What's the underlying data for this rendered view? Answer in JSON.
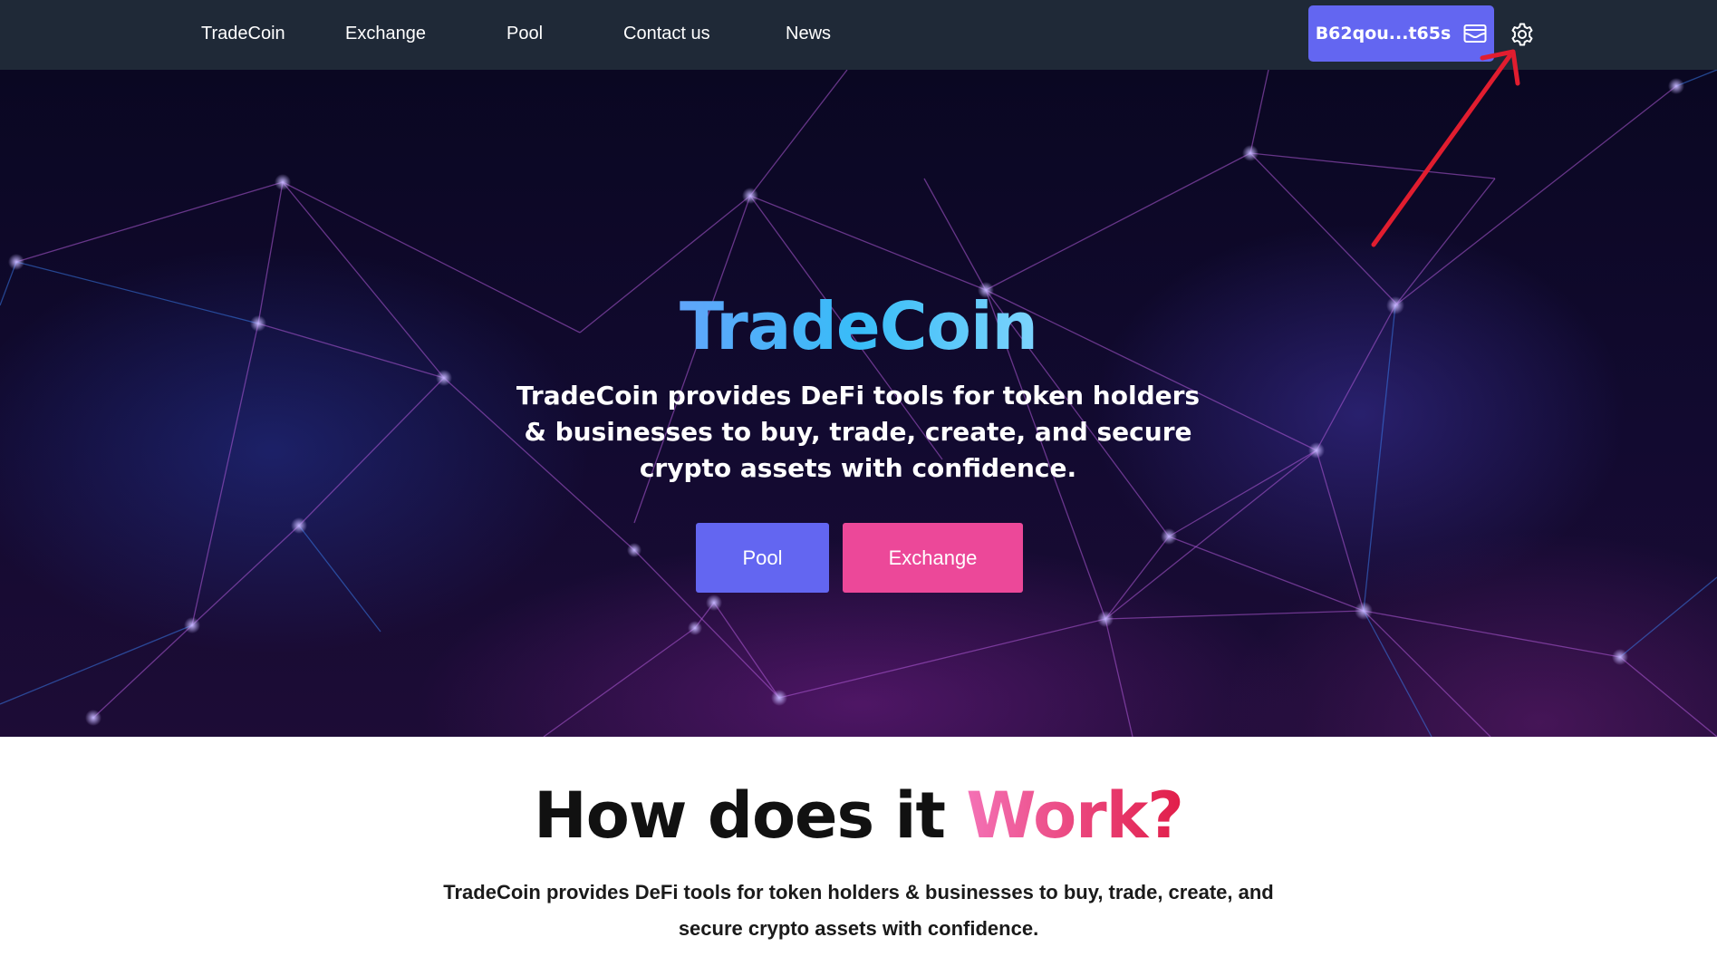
{
  "nav": {
    "links": [
      "TradeCoin",
      "Exchange",
      "Pool",
      "Contact us",
      "News"
    ],
    "wallet_label": "B62qou...t65s",
    "wallet_icon": "wallet-icon",
    "settings_icon": "gear-icon"
  },
  "hero": {
    "title": "TradeCoin",
    "subtitle": "TradeCoin provides DeFi tools for token holders & businesses to buy, trade, create, and secure crypto assets with confidence.",
    "pool_button": "Pool",
    "exchange_button": "Exchange"
  },
  "how": {
    "title_main": "How does it ",
    "title_accent": "Work?",
    "description": "TradeCoin provides DeFi tools for token holders & businesses to buy, trade, create, and secure crypto assets with confidence."
  },
  "colors": {
    "navbar": "#1f2937",
    "primary": "#6366f1",
    "pink": "#ec4899",
    "annotation": "#e11d2f"
  }
}
